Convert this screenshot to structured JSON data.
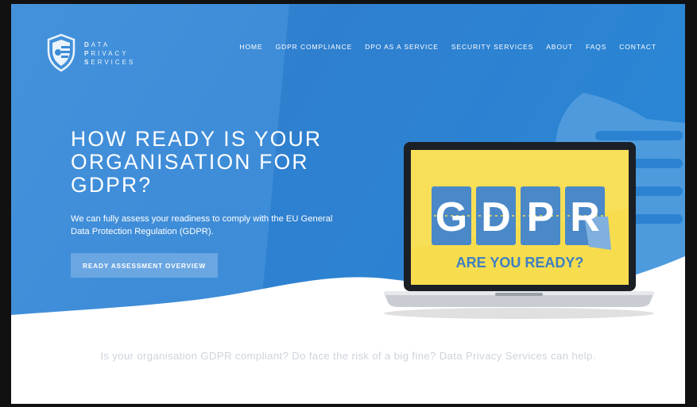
{
  "brand": {
    "line1": [
      "D",
      "ATA"
    ],
    "line2": [
      "P",
      "RIVACY"
    ],
    "line3": [
      "S",
      "ERVICES"
    ]
  },
  "nav": {
    "items": [
      {
        "label": "HOME"
      },
      {
        "label": "GDPR COMPLIANCE"
      },
      {
        "label": "DPO AS A SERVICE"
      },
      {
        "label": "SECURITY SERVICES"
      },
      {
        "label": "ABOUT"
      },
      {
        "label": "FAQS"
      },
      {
        "label": "CONTACT"
      }
    ]
  },
  "hero": {
    "headline": "HOW READY IS YOUR ORGANISATION FOR GDPR?",
    "subtext": "We can fully assess your readiness to comply with the EU General Data Protection Regulation (GDPR).",
    "cta_label": "READY ASSESSMENT OVERVIEW"
  },
  "screen": {
    "letters": [
      "G",
      "D",
      "P",
      "R"
    ],
    "question": "ARE YOU READY?"
  },
  "tagline": "Is your organisation GDPR compliant? Do face the risk of a big fine? Data Privacy Services can help.",
  "colors": {
    "hero_blue": "#2f80d0",
    "hero_light": "#4a98e0",
    "screen_yellow": "#f7dd4d",
    "tile_blue": "#4a88c8",
    "cta_blue": "#6aa6e2"
  },
  "icons": {
    "logo": "shield-logo-icon",
    "background_shield": "shield-watermark-icon"
  }
}
